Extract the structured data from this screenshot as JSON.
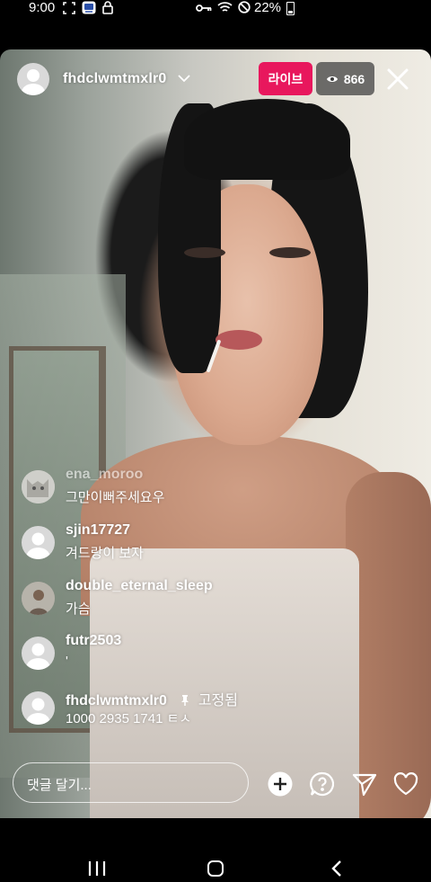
{
  "status_bar": {
    "time": "9:00",
    "battery": "22%",
    "icons": [
      "screenshot-icon",
      "app-notification-icon",
      "lock-icon",
      "key-icon",
      "wifi-icon",
      "do-not-disturb-icon",
      "battery-icon"
    ]
  },
  "header": {
    "username": "fhdclwmtmxlr0",
    "live_label": "라이브",
    "viewer_count": "866",
    "icons": [
      "chevron-down-icon",
      "eye-icon",
      "close-icon"
    ]
  },
  "comments": [
    {
      "user": "ena_moroo",
      "text": "그만이뻐주세요우",
      "avatar": "cat-avatar"
    },
    {
      "user": "sjin17727",
      "text": "겨드랑이 보자",
      "avatar": "default-avatar"
    },
    {
      "user": "double_eternal_sleep",
      "text": "가슴",
      "avatar": "photo-avatar"
    },
    {
      "user": "futr2503",
      "text": "'",
      "avatar": "default-avatar"
    },
    {
      "user": "fhdclwmtmxlr0",
      "pinned_label": "고정됨",
      "text": "1000 2935 1741 ㅌㅅ",
      "avatar": "default-avatar"
    }
  ],
  "bottom_bar": {
    "comment_placeholder": "댓글 달기...",
    "icons": [
      "add-icon",
      "question-icon",
      "send-icon",
      "heart-icon"
    ]
  },
  "colors": {
    "live_badge": "#e8175d",
    "viewer_badge": "#3c3c3c"
  }
}
